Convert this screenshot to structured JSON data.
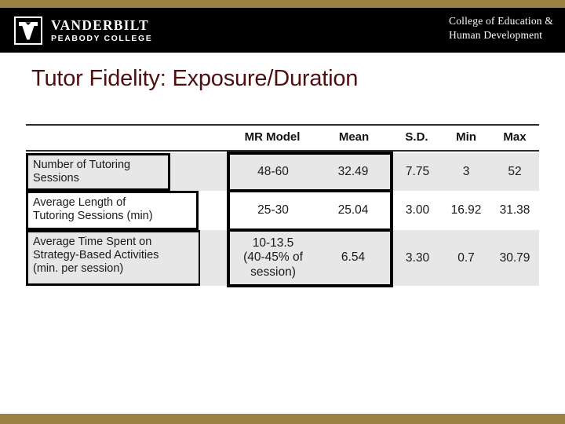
{
  "banner": {
    "gold_color": "#9a8144",
    "bar_color": "#000000",
    "logo": {
      "shield_icon": "vanderbilt-v-shield-icon",
      "university": "VANDERBILT",
      "school": "PEABODY COLLEGE"
    },
    "college_line1": "College of Education &",
    "college_line2": "Human Development"
  },
  "title": {
    "text": "Tutor Fidelity: Exposure/Duration",
    "color": "#4d0f0f"
  },
  "table": {
    "columns": [
      "",
      "",
      "MR Model",
      "Mean",
      "S.D.",
      "Min",
      "Max"
    ],
    "headers": {
      "label": "",
      "gap": "",
      "mr_model": "MR Model",
      "mean": "Mean",
      "sd": "S.D.",
      "min": "Min",
      "max": "Max"
    },
    "rows": [
      {
        "label_line1": "Number of Tutoring",
        "label_line2": "Sessions",
        "label": "Number of Tutoring Sessions",
        "mr_model": "48-60",
        "mean": "32.49",
        "sd": "7.75",
        "min": "3",
        "max": "52",
        "shaded": true
      },
      {
        "label_line1": "Average Length of",
        "label_line2": "Tutoring Sessions (min)",
        "label": "Average Length of Tutoring Sessions (min)",
        "mr_model": "25-30",
        "mean": "25.04",
        "sd": "3.00",
        "min": "16.92",
        "max": "31.38",
        "shaded": false
      },
      {
        "label_line1": "Average Time Spent on",
        "label_line2": "Strategy-Based Activities",
        "label_line3": "(min. per session)",
        "label": "Average Time Spent on Strategy-Based Activities (min. per session)",
        "mr_model_line1": "10-13.5",
        "mr_model_line2": "(40-45% of",
        "mr_model_line3": "session)",
        "mr_model": "10-13.5 (40-45% of session)",
        "mean": "6.54",
        "sd": "3.30",
        "min": "0.7",
        "max": "30.79",
        "shaded": true
      }
    ]
  }
}
